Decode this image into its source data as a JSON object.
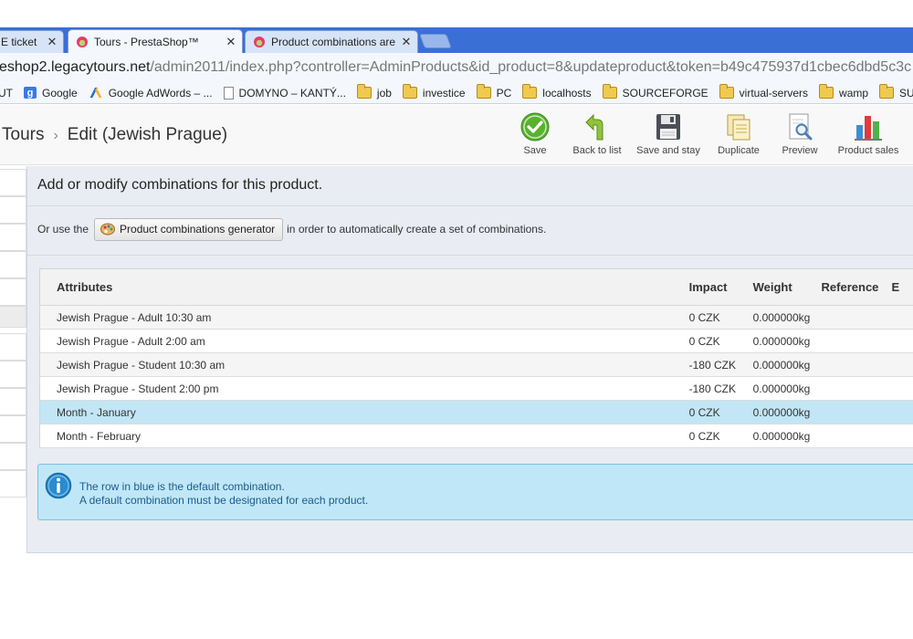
{
  "browser": {
    "tabs": [
      {
        "title": "E ticket",
        "active": false
      },
      {
        "title": "Tours - PrestaShop™",
        "active": true
      },
      {
        "title": "Product combinations are",
        "active": false
      }
    ],
    "close_glyph": "✕",
    "url_host": "eshop2.legacytours.net",
    "url_path": "/admin2011/index.php?controller=AdminProducts&id_product=8&updateproduct&token=b49c475937d1cbec6dbd5c3c",
    "bookmarks": [
      {
        "label": "UT",
        "icon": "partial-icon"
      },
      {
        "label": "Google",
        "icon": "google-icon"
      },
      {
        "label": "Google AdWords – ...",
        "icon": "adwords-icon"
      },
      {
        "label": "DOMYNO – KANTÝ...",
        "icon": "page-icon"
      },
      {
        "label": "job",
        "icon": "folder-icon"
      },
      {
        "label": "investice",
        "icon": "folder-icon"
      },
      {
        "label": "PC",
        "icon": "folder-icon"
      },
      {
        "label": "localhosts",
        "icon": "folder-icon"
      },
      {
        "label": "SOURCEFORGE",
        "icon": "folder-icon"
      },
      {
        "label": "virtual-servers",
        "icon": "folder-icon"
      },
      {
        "label": "wamp",
        "icon": "folder-icon"
      },
      {
        "label": "SUPER",
        "icon": "folder-icon"
      }
    ]
  },
  "header": {
    "breadcrumb_root": "Tours",
    "breadcrumb_sep": "›",
    "breadcrumb_current": "Edit (Jewish Prague)",
    "toolbar": {
      "save": "Save",
      "back": "Back to list",
      "save_stay": "Save and stay",
      "duplicate": "Duplicate",
      "preview": "Preview",
      "sales": "Product sales"
    }
  },
  "panel": {
    "title": "Add or modify combinations for this product.",
    "gen_prefix": "Or use the",
    "gen_button": "Product combinations generator",
    "gen_suffix": "in order to automatically create a set of combinations."
  },
  "table": {
    "headers": {
      "attributes": "Attributes",
      "impact": "Impact",
      "weight": "Weight",
      "reference": "Reference",
      "more": "E"
    },
    "rows": [
      {
        "attributes": "Jewish Prague - Adult 10:30 am",
        "impact": "0 CZK",
        "weight": "0.000000kg",
        "default": false
      },
      {
        "attributes": "Jewish Prague - Adult 2:00 am",
        "impact": "0 CZK",
        "weight": "0.000000kg",
        "default": false
      },
      {
        "attributes": "Jewish Prague - Student 10:30 am",
        "impact": "-180 CZK",
        "weight": "0.000000kg",
        "default": false
      },
      {
        "attributes": "Jewish Prague - Student 2:00 pm",
        "impact": "-180 CZK",
        "weight": "0.000000kg",
        "default": false
      },
      {
        "attributes": "Month - January",
        "impact": "0 CZK",
        "weight": "0.000000kg",
        "default": true
      },
      {
        "attributes": "Month - February",
        "impact": "0 CZK",
        "weight": "0.000000kg",
        "default": false
      }
    ]
  },
  "info": {
    "line1": "The row in blue is the default combination.",
    "line2": "A default combination must be designated for each product."
  },
  "colors": {
    "default_row": "#c2e6f5",
    "info_bg": "#bfe7f8",
    "tabstrip": "#3a6fd6"
  }
}
